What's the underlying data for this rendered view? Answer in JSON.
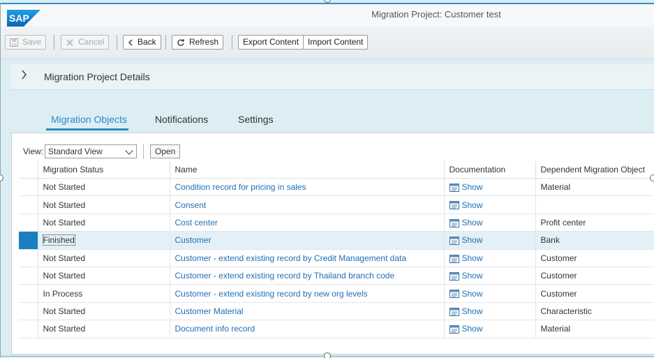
{
  "window": {
    "title": "Migration Project: Customer test"
  },
  "logo": {
    "text": "SAP",
    "color": "#0a6ed1"
  },
  "toolbar": {
    "save": "Save",
    "cancel": "Cancel",
    "back": "Back",
    "refresh": "Refresh",
    "export": "Export Content",
    "import": "Import Content"
  },
  "details": {
    "title": "Migration Project Details"
  },
  "tabs": [
    {
      "label": "Migration Objects",
      "active": true
    },
    {
      "label": "Notifications",
      "active": false
    },
    {
      "label": "Settings",
      "active": false
    }
  ],
  "view": {
    "label": "View:",
    "selected": "Standard View",
    "open_label": "Open"
  },
  "table": {
    "headers": [
      "Migration Status",
      "Name",
      "Documentation",
      "Dependent Migration Object"
    ],
    "rows": [
      {
        "status": "Not Started",
        "name": "Condition record for pricing in sales",
        "doc": "Show",
        "dependent": "Material"
      },
      {
        "status": "Not Started",
        "name": "Consent",
        "doc": "Show",
        "dependent": ""
      },
      {
        "status": "Not Started",
        "name": "Cost center",
        "doc": "Show",
        "dependent": "Profit center"
      },
      {
        "status": "Finished",
        "name": "Customer",
        "doc": "Show",
        "dependent": "Bank",
        "selected": true
      },
      {
        "status": "Not Started",
        "name": "Customer - extend existing record by Credit Management data",
        "doc": "Show",
        "dependent": "Customer"
      },
      {
        "status": "Not Started",
        "name": "Customer - extend existing record by Thailand branch code",
        "doc": "Show",
        "dependent": "Customer"
      },
      {
        "status": "In Process",
        "name": "Customer - extend existing record by new org levels",
        "doc": "Show",
        "dependent": "Customer"
      },
      {
        "status": "Not Started",
        "name": "Customer Material",
        "doc": "Show",
        "dependent": "Characteristic"
      },
      {
        "status": "Not Started",
        "name": "Document info record",
        "doc": "Show",
        "dependent": "Material"
      }
    ]
  },
  "colors": {
    "accent": "#2a8ac6",
    "link": "#1f6fb5",
    "selected_row": "#e4f0f7",
    "row_marker": "#1a7fc1"
  }
}
